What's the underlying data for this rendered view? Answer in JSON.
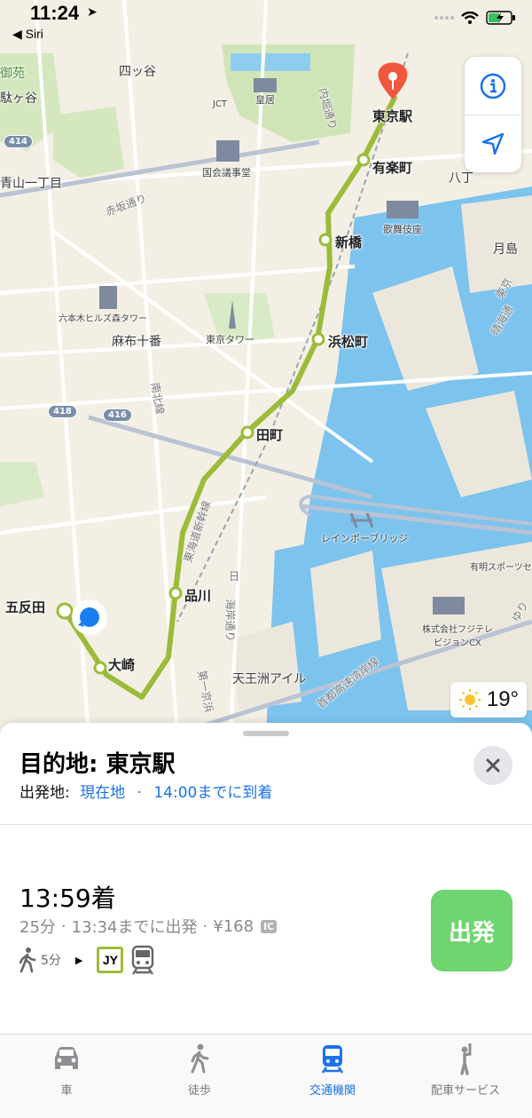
{
  "status": {
    "time": "11:24",
    "back_label": "◀ Siri"
  },
  "map": {
    "stations": [
      "東京駅",
      "有楽町",
      "新橋",
      "浜松町",
      "田町",
      "品川",
      "大崎",
      "五反田"
    ],
    "places": {
      "imperial_palace": "皇居",
      "diet": "国会議事堂",
      "kabukiza": "歌舞伎座",
      "hills": "六本木ヒルズ森タワー",
      "tower": "東京タワー",
      "azabu": "麻布十番",
      "yotsuya": "四ッ谷",
      "aoyama": "青山一丁目",
      "gyoen": "御苑",
      "sendagaya": "駄ヶ谷",
      "akasaka": "赤坂通り",
      "minamikita": "南北線",
      "tokaido": "東海道新幹線",
      "uchibori": "内堀通り",
      "rainbow": "レインボーブリッジ",
      "ariake": "有明スポーツセ",
      "fuji": "株式会社フジテレ\nビジョンCX",
      "tennozu": "天王洲アイル",
      "kaigan": "海岸通り",
      "hiro": "日",
      "keihin": "第一京浜",
      "shuto": "首都高速湾岸線",
      "hattchobori": "八丁",
      "tsukishima": "月島",
      "harumi": "晴海通",
      "higashi": "東京",
      "yuri": "ゆり",
      "jct": "JCT"
    },
    "route_shields": [
      "414",
      "418",
      "416"
    ]
  },
  "controls": {
    "info_icon": "info-icon",
    "location_icon": "location-arrow-icon"
  },
  "weather": {
    "temp": "19°",
    "icon": "sun-icon"
  },
  "sheet": {
    "title": "目的地: 東京駅",
    "origin_label": "出発地:",
    "origin_value": "現在地",
    "arrive_by": "14:00までに到着",
    "route": {
      "arrival": "13:59着",
      "duration": "25分",
      "depart": "13:34までに出発",
      "fare": "¥168",
      "ic_badge": "IC",
      "walk_minutes": "5分",
      "line_code": "JY"
    },
    "go_label": "出発"
  },
  "tabs": [
    {
      "label": "車",
      "icon": "car-icon",
      "active": false
    },
    {
      "label": "徒歩",
      "icon": "walk-icon",
      "active": false
    },
    {
      "label": "交通機関",
      "icon": "train-icon",
      "active": true
    },
    {
      "label": "配車サービス",
      "icon": "ride-hail-icon",
      "active": false
    }
  ],
  "colors": {
    "accent": "#1a73e8",
    "route_line": "#9bbc3a",
    "go_button": "#6fd56f",
    "water": "#7cc3ee",
    "pin": "#f0573c"
  }
}
